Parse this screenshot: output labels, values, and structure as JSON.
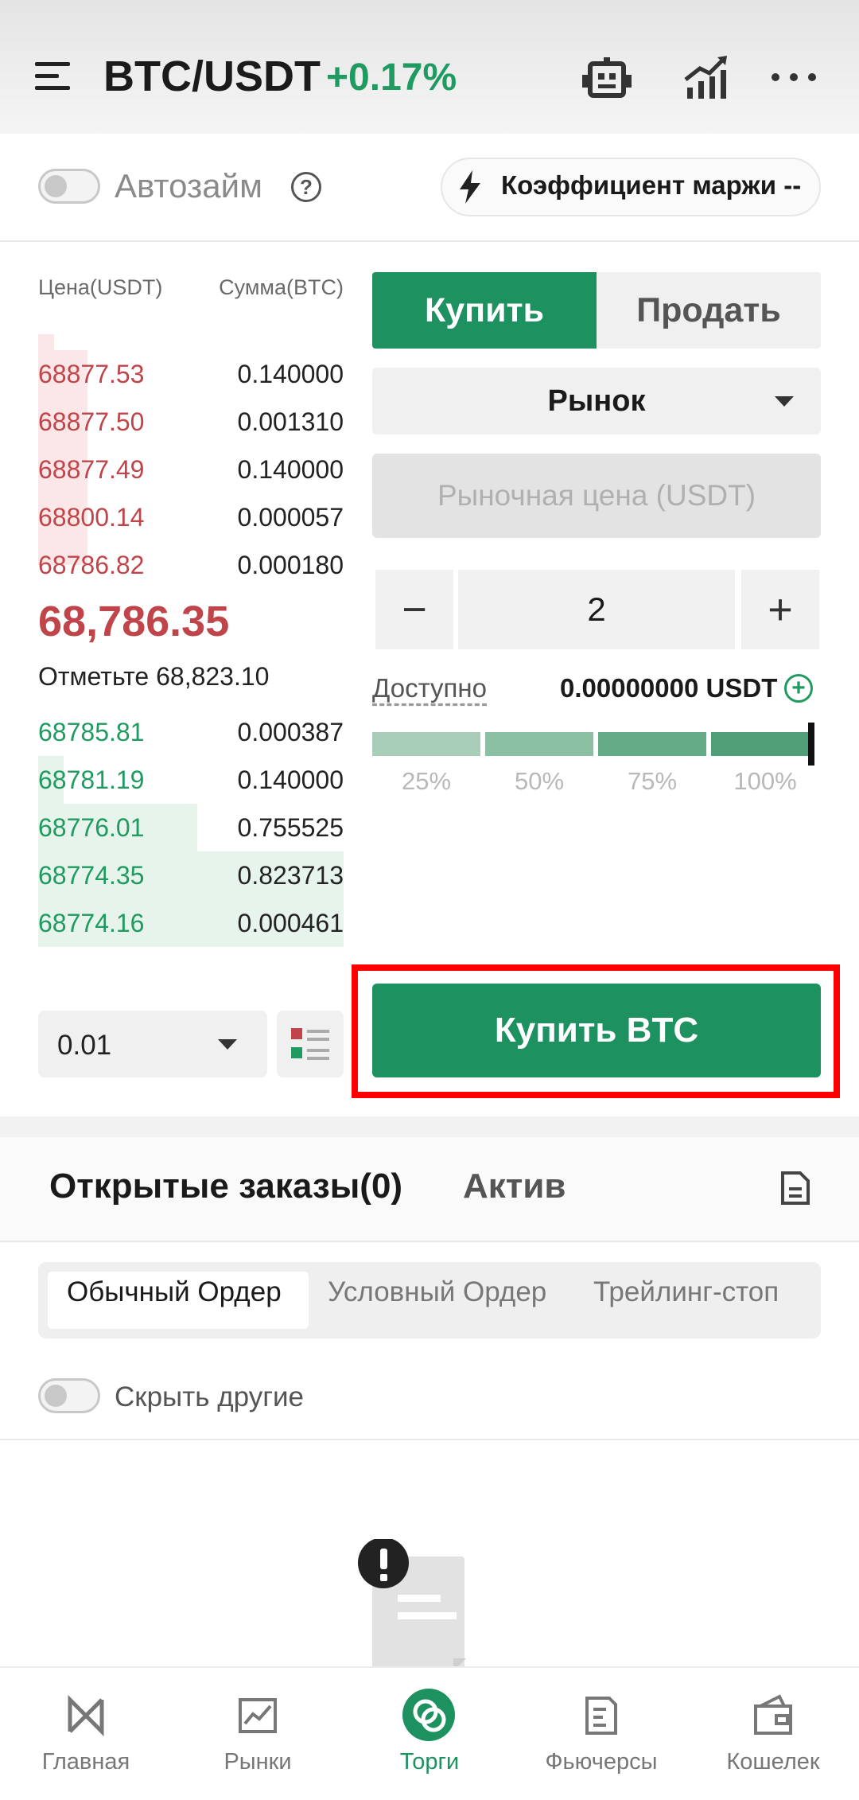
{
  "header": {
    "pair": "BTC/USDT",
    "change": "+0.17%"
  },
  "controls": {
    "auto_loan_label": "Автозайм",
    "margin_label": "Коэффициент маржи --"
  },
  "order_book": {
    "price_header": "Цена(USDT)",
    "amount_header": "Сумма(BTC)",
    "asks": [
      {
        "price": "68877.53",
        "amount": "0.140000"
      },
      {
        "price": "68877.50",
        "amount": "0.001310"
      },
      {
        "price": "68877.49",
        "amount": "0.140000"
      },
      {
        "price": "68800.14",
        "amount": "0.000057"
      },
      {
        "price": "68786.82",
        "amount": "0.000180"
      }
    ],
    "last_price": "68,786.35",
    "mark_price": "Отметьте 68,823.10",
    "bids": [
      {
        "price": "68785.81",
        "amount": "0.000387"
      },
      {
        "price": "68781.19",
        "amount": "0.140000"
      },
      {
        "price": "68776.01",
        "amount": "0.755525"
      },
      {
        "price": "68774.35",
        "amount": "0.823713"
      },
      {
        "price": "68774.16",
        "amount": "0.000461"
      }
    ],
    "depth": "0.01"
  },
  "trade_panel": {
    "buy_tab": "Купить",
    "sell_tab": "Продать",
    "order_type": "Рынок",
    "price_placeholder": "Рыночная цена (USDT)",
    "quantity": "2",
    "minus": "−",
    "plus": "+",
    "available_label": "Доступно",
    "available_value": "0.00000000 USDT",
    "percent_options": [
      "25%",
      "50%",
      "75%",
      "100%"
    ],
    "submit_label": "Купить BTC"
  },
  "orders": {
    "open_orders_tab": "Открытые заказы(0)",
    "assets_tab": "Актив",
    "sub_tabs": [
      "Обычный Ордер",
      "Условный Ордер",
      "Трейлинг-стоп"
    ],
    "hide_others_label": "Скрыть другие"
  },
  "bottom_nav": [
    {
      "label": "Главная",
      "icon": "home-logo-icon"
    },
    {
      "label": "Рынки",
      "icon": "markets-chart-icon"
    },
    {
      "label": "Торги",
      "icon": "trade-icon"
    },
    {
      "label": "Фьючерсы",
      "icon": "futures-icon"
    },
    {
      "label": "Кошелек",
      "icon": "wallet-icon"
    }
  ],
  "colors": {
    "accent_green": "#1e9160",
    "ask_red": "#c0454a",
    "bid_green": "#1f9a60",
    "highlight": "#ff0000"
  }
}
